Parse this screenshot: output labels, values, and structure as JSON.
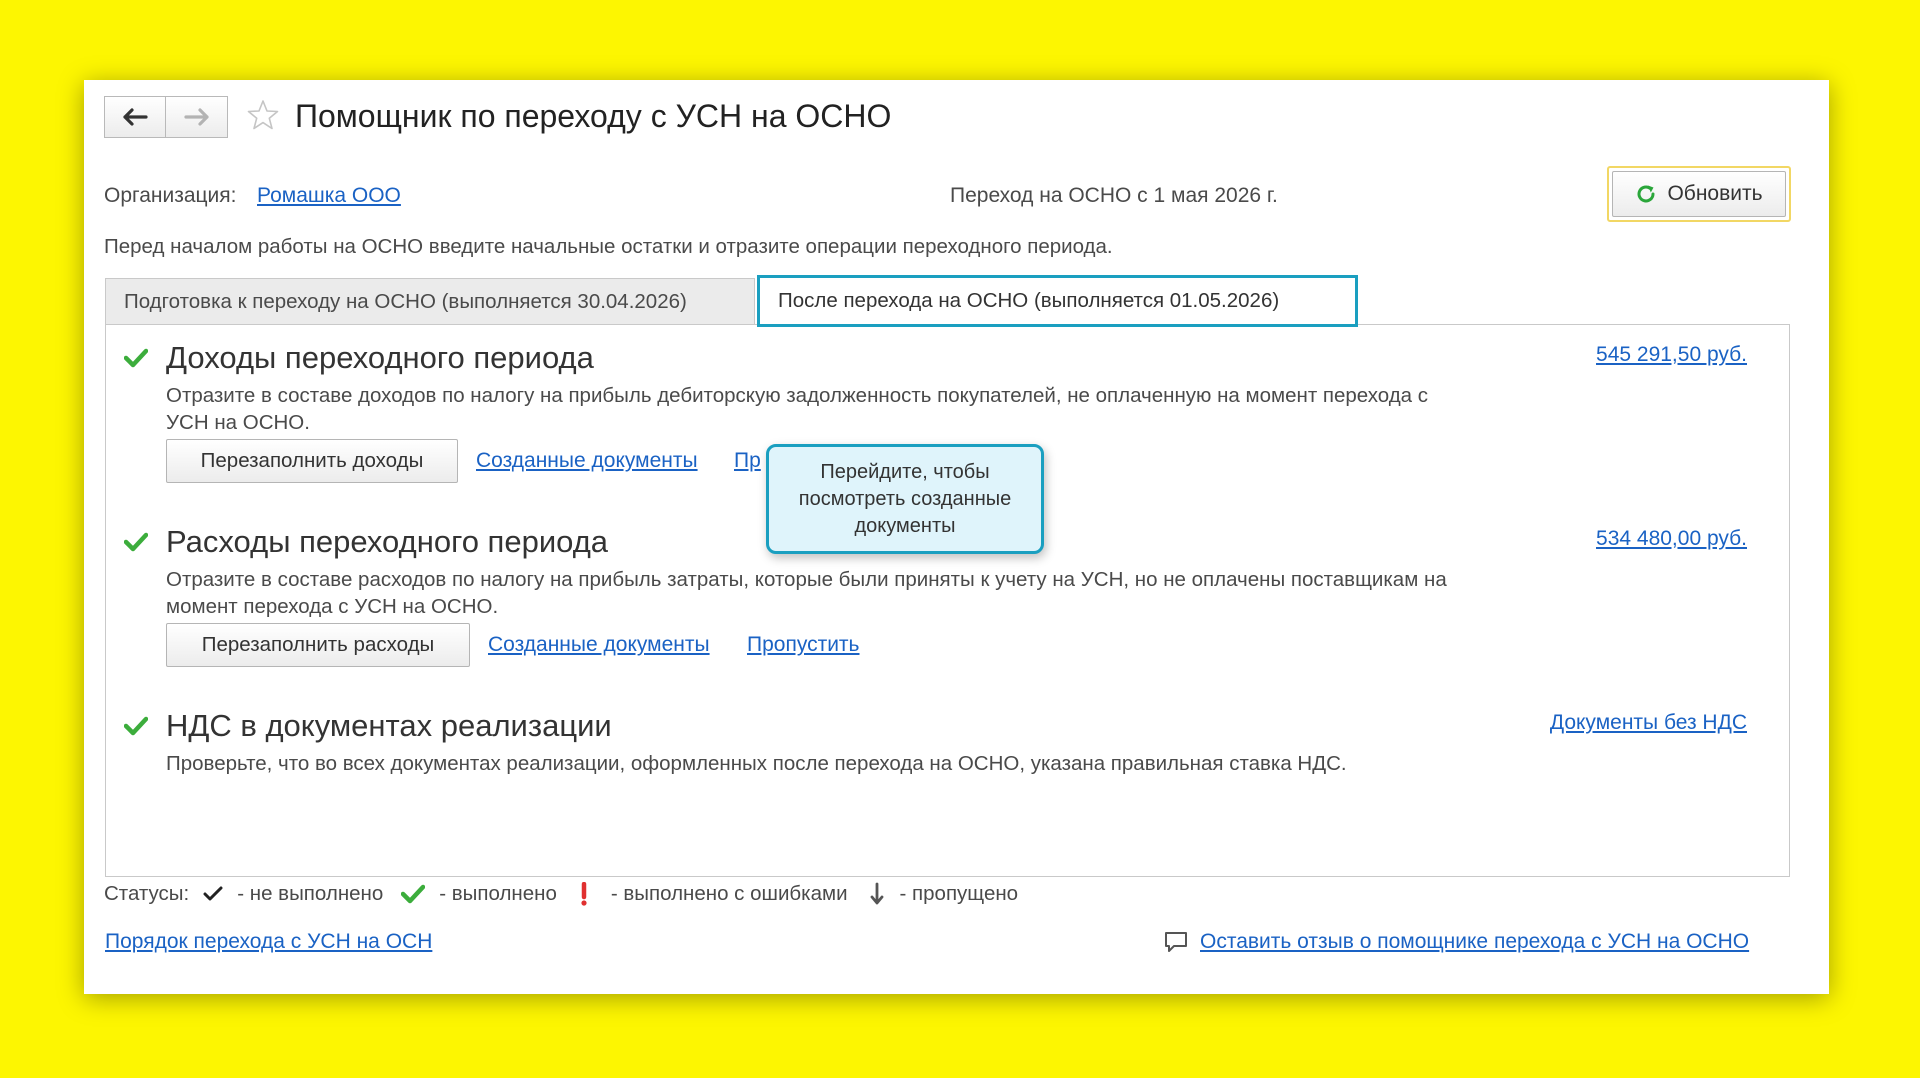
{
  "header": {
    "back_icon": "arrow-left-icon",
    "forward_icon": "arrow-right-icon",
    "star_icon": "star-icon",
    "title": "Помощник по переходу с УСН на ОСНО"
  },
  "org": {
    "label": "Организация:",
    "value": "Ромашка ООО"
  },
  "transition_date": "Переход на ОСНО с 1 мая 2026 г.",
  "refresh_button": {
    "icon": "refresh-icon",
    "label": "Обновить"
  },
  "intro": "Перед началом работы на ОСНО введите начальные остатки и отразите операции переходного периода.",
  "tabs": [
    {
      "label": "Подготовка к переходу на ОСНО (выполняется 30.04.2026)",
      "active": false
    },
    {
      "label": "После перехода на ОСНО (выполняется 01.05.2026)",
      "active": true
    }
  ],
  "sections": {
    "income": {
      "title": "Доходы переходного периода",
      "amount": "545 291,50 руб.",
      "description": "Отразите в составе доходов по налогу на прибыль дебиторскую задолженность покупателей, не оплаченную на момент перехода с УСН на ОСНО.",
      "button": "Перезаполнить доходы",
      "docs_link": "Созданные документы",
      "skip_link_partial": "Пр"
    },
    "expenses": {
      "title": "Расходы переходного периода",
      "amount": "534 480,00 руб.",
      "description": "Отразите в составе расходов по налогу на прибыль затраты, которые были приняты к учету на УСН, но не оплачены поставщикам на момент перехода с УСН на ОСНО.",
      "button": "Перезаполнить расходы",
      "docs_link": "Созданные документы",
      "skip_link": "Пропустить"
    },
    "vat": {
      "title": "НДС в документах реализации",
      "link": "Документы без НДС",
      "description": "Проверьте, что во всех документах реализации, оформленных после перехода на ОСНО, указана правильная ставка НДС."
    }
  },
  "tooltip": "Перейдите, чтобы посмотреть созданные документы",
  "statuses": {
    "label": "Статусы:",
    "not_done": "- не выполнено",
    "done": "- выполнено",
    "errors": "- выполнено с ошибками",
    "skipped": "- пропущено"
  },
  "footer": {
    "order_link": "Порядок перехода с УСН на ОСН",
    "feedback_icon": "speech-bubble-icon",
    "feedback_link": "Оставить отзыв о помощнике перехода с УСН на ОСНО"
  },
  "colors": {
    "background": "#fdf601",
    "link": "#1a62c4",
    "accent": "#1a9fc0",
    "check": "#3cad3c",
    "error": "#e03030"
  }
}
